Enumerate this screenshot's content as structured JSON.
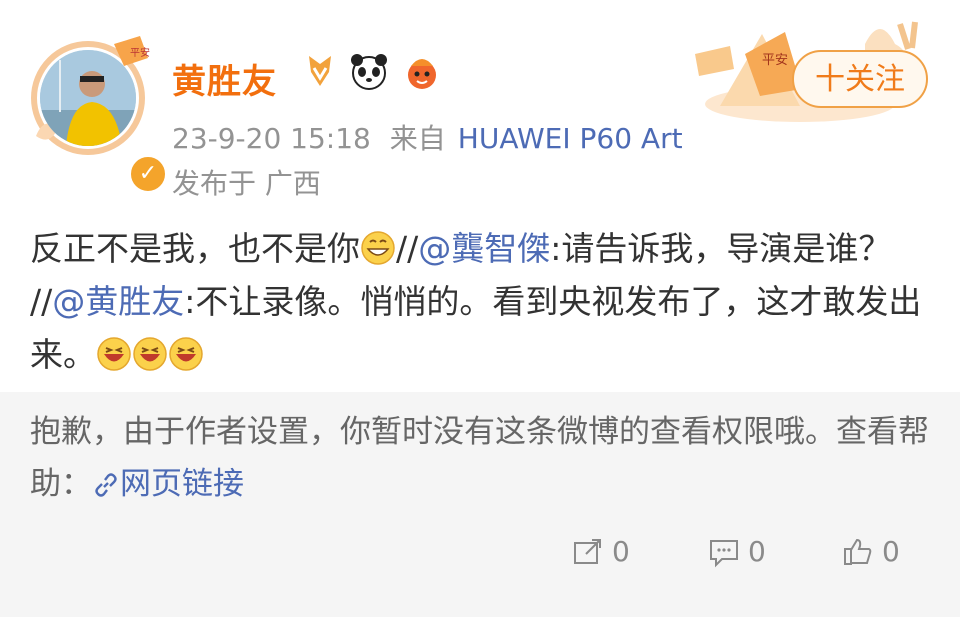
{
  "user": {
    "name": "黄胜友",
    "time": "23-9-20 15:18",
    "source_prefix": "来自",
    "device": "HUAWEI P60 Art",
    "location": "发布于 广西",
    "avatar_badge_text": "平安"
  },
  "follow": {
    "label": "十关注",
    "decor_text": "平安"
  },
  "post": {
    "part1": "反正不是我，也不是你",
    "sep1": "//",
    "mention1": "@龔智傑",
    "part2": ":请告诉我，导演是谁？",
    "sep2": "//",
    "mention2": "@黄胜友",
    "part3": ":不让录像。悄悄的。看到央视发布了，这才敢发出来。"
  },
  "retweet": {
    "message": "抱歉，由于作者设置，你暂时没有这条微博的查看权限哦。查看帮助：",
    "link_label": "网页链接"
  },
  "actions": {
    "share_count": "0",
    "comment_count": "0",
    "like_count": "0"
  },
  "colors": {
    "username": "#f26f0e",
    "link": "#4d6bb5",
    "meta": "#939393",
    "retweet_bg": "#f5f5f5"
  },
  "icons": [
    "verified-badge-icon",
    "vip-badge-icon",
    "panda-icon",
    "mascot-icon",
    "link-icon",
    "share-icon",
    "comment-icon",
    "like-icon"
  ]
}
